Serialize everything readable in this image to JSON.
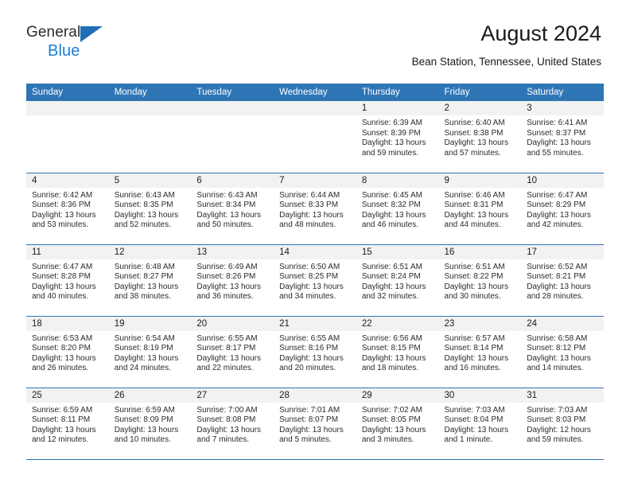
{
  "brand": {
    "name_line1": "General",
    "name_line2": "Blue",
    "triangle_icon": "triangle-logo-icon",
    "accent_dark": "#1f6fb5",
    "accent_light": "#1a7fd4"
  },
  "header": {
    "month_title": "August 2024",
    "location": "Bean Station, Tennessee, United States"
  },
  "theme": {
    "header_blue": "#2e75b6",
    "daynum_band": "#f2f2f2",
    "row_divider": "#2e75b6",
    "text": "#2b2b2b"
  },
  "calendar": {
    "weekday_headers": [
      "Sunday",
      "Monday",
      "Tuesday",
      "Wednesday",
      "Thursday",
      "Friday",
      "Saturday"
    ],
    "labels": {
      "sunrise": "Sunrise:",
      "sunset": "Sunset:",
      "daylight": "Daylight:"
    },
    "weeks": [
      [
        {
          "day": "",
          "lines": []
        },
        {
          "day": "",
          "lines": []
        },
        {
          "day": "",
          "lines": []
        },
        {
          "day": "",
          "lines": []
        },
        {
          "day": "1",
          "lines": [
            "Sunrise: 6:39 AM",
            "Sunset: 8:39 PM",
            "Daylight: 13 hours",
            "and 59 minutes."
          ]
        },
        {
          "day": "2",
          "lines": [
            "Sunrise: 6:40 AM",
            "Sunset: 8:38 PM",
            "Daylight: 13 hours",
            "and 57 minutes."
          ]
        },
        {
          "day": "3",
          "lines": [
            "Sunrise: 6:41 AM",
            "Sunset: 8:37 PM",
            "Daylight: 13 hours",
            "and 55 minutes."
          ]
        }
      ],
      [
        {
          "day": "4",
          "lines": [
            "Sunrise: 6:42 AM",
            "Sunset: 8:36 PM",
            "Daylight: 13 hours",
            "and 53 minutes."
          ]
        },
        {
          "day": "5",
          "lines": [
            "Sunrise: 6:43 AM",
            "Sunset: 8:35 PM",
            "Daylight: 13 hours",
            "and 52 minutes."
          ]
        },
        {
          "day": "6",
          "lines": [
            "Sunrise: 6:43 AM",
            "Sunset: 8:34 PM",
            "Daylight: 13 hours",
            "and 50 minutes."
          ]
        },
        {
          "day": "7",
          "lines": [
            "Sunrise: 6:44 AM",
            "Sunset: 8:33 PM",
            "Daylight: 13 hours",
            "and 48 minutes."
          ]
        },
        {
          "day": "8",
          "lines": [
            "Sunrise: 6:45 AM",
            "Sunset: 8:32 PM",
            "Daylight: 13 hours",
            "and 46 minutes."
          ]
        },
        {
          "day": "9",
          "lines": [
            "Sunrise: 6:46 AM",
            "Sunset: 8:31 PM",
            "Daylight: 13 hours",
            "and 44 minutes."
          ]
        },
        {
          "day": "10",
          "lines": [
            "Sunrise: 6:47 AM",
            "Sunset: 8:29 PM",
            "Daylight: 13 hours",
            "and 42 minutes."
          ]
        }
      ],
      [
        {
          "day": "11",
          "lines": [
            "Sunrise: 6:47 AM",
            "Sunset: 8:28 PM",
            "Daylight: 13 hours",
            "and 40 minutes."
          ]
        },
        {
          "day": "12",
          "lines": [
            "Sunrise: 6:48 AM",
            "Sunset: 8:27 PM",
            "Daylight: 13 hours",
            "and 38 minutes."
          ]
        },
        {
          "day": "13",
          "lines": [
            "Sunrise: 6:49 AM",
            "Sunset: 8:26 PM",
            "Daylight: 13 hours",
            "and 36 minutes."
          ]
        },
        {
          "day": "14",
          "lines": [
            "Sunrise: 6:50 AM",
            "Sunset: 8:25 PM",
            "Daylight: 13 hours",
            "and 34 minutes."
          ]
        },
        {
          "day": "15",
          "lines": [
            "Sunrise: 6:51 AM",
            "Sunset: 8:24 PM",
            "Daylight: 13 hours",
            "and 32 minutes."
          ]
        },
        {
          "day": "16",
          "lines": [
            "Sunrise: 6:51 AM",
            "Sunset: 8:22 PM",
            "Daylight: 13 hours",
            "and 30 minutes."
          ]
        },
        {
          "day": "17",
          "lines": [
            "Sunrise: 6:52 AM",
            "Sunset: 8:21 PM",
            "Daylight: 13 hours",
            "and 28 minutes."
          ]
        }
      ],
      [
        {
          "day": "18",
          "lines": [
            "Sunrise: 6:53 AM",
            "Sunset: 8:20 PM",
            "Daylight: 13 hours",
            "and 26 minutes."
          ]
        },
        {
          "day": "19",
          "lines": [
            "Sunrise: 6:54 AM",
            "Sunset: 8:19 PM",
            "Daylight: 13 hours",
            "and 24 minutes."
          ]
        },
        {
          "day": "20",
          "lines": [
            "Sunrise: 6:55 AM",
            "Sunset: 8:17 PM",
            "Daylight: 13 hours",
            "and 22 minutes."
          ]
        },
        {
          "day": "21",
          "lines": [
            "Sunrise: 6:55 AM",
            "Sunset: 8:16 PM",
            "Daylight: 13 hours",
            "and 20 minutes."
          ]
        },
        {
          "day": "22",
          "lines": [
            "Sunrise: 6:56 AM",
            "Sunset: 8:15 PM",
            "Daylight: 13 hours",
            "and 18 minutes."
          ]
        },
        {
          "day": "23",
          "lines": [
            "Sunrise: 6:57 AM",
            "Sunset: 8:14 PM",
            "Daylight: 13 hours",
            "and 16 minutes."
          ]
        },
        {
          "day": "24",
          "lines": [
            "Sunrise: 6:58 AM",
            "Sunset: 8:12 PM",
            "Daylight: 13 hours",
            "and 14 minutes."
          ]
        }
      ],
      [
        {
          "day": "25",
          "lines": [
            "Sunrise: 6:59 AM",
            "Sunset: 8:11 PM",
            "Daylight: 13 hours",
            "and 12 minutes."
          ]
        },
        {
          "day": "26",
          "lines": [
            "Sunrise: 6:59 AM",
            "Sunset: 8:09 PM",
            "Daylight: 13 hours",
            "and 10 minutes."
          ]
        },
        {
          "day": "27",
          "lines": [
            "Sunrise: 7:00 AM",
            "Sunset: 8:08 PM",
            "Daylight: 13 hours",
            "and 7 minutes."
          ]
        },
        {
          "day": "28",
          "lines": [
            "Sunrise: 7:01 AM",
            "Sunset: 8:07 PM",
            "Daylight: 13 hours",
            "and 5 minutes."
          ]
        },
        {
          "day": "29",
          "lines": [
            "Sunrise: 7:02 AM",
            "Sunset: 8:05 PM",
            "Daylight: 13 hours",
            "and 3 minutes."
          ]
        },
        {
          "day": "30",
          "lines": [
            "Sunrise: 7:03 AM",
            "Sunset: 8:04 PM",
            "Daylight: 13 hours",
            "and 1 minute."
          ]
        },
        {
          "day": "31",
          "lines": [
            "Sunrise: 7:03 AM",
            "Sunset: 8:03 PM",
            "Daylight: 12 hours",
            "and 59 minutes."
          ]
        }
      ]
    ]
  }
}
